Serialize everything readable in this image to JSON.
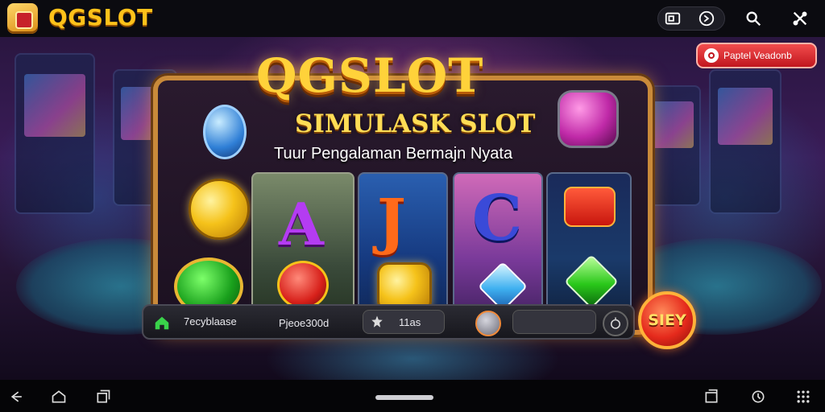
{
  "app": {
    "title": "QGSLOT"
  },
  "promo": {
    "label": "Paptel Veadonb"
  },
  "game": {
    "logo": "QGSLOT",
    "subtitle": "SIMULASK SLOT",
    "tagline": "Tuur Pengalaman Bermajn Nyata"
  },
  "controls": {
    "balance_label": "7ecyblaase",
    "bet_label": "Pjeoe300d",
    "lines_value": "11as",
    "spin_label": "SIEY"
  },
  "icons": {
    "top": [
      "screenshot-icon",
      "forward-circle-icon",
      "search-icon",
      "close-tools-icon"
    ],
    "nav": [
      "back-icon",
      "home-icon",
      "recents-icon",
      "window-icon",
      "settings-icon",
      "grid-icon"
    ]
  },
  "colors": {
    "accent": "#ffc21a",
    "promo": "#d92a2a",
    "frame": "#c98a3a"
  }
}
